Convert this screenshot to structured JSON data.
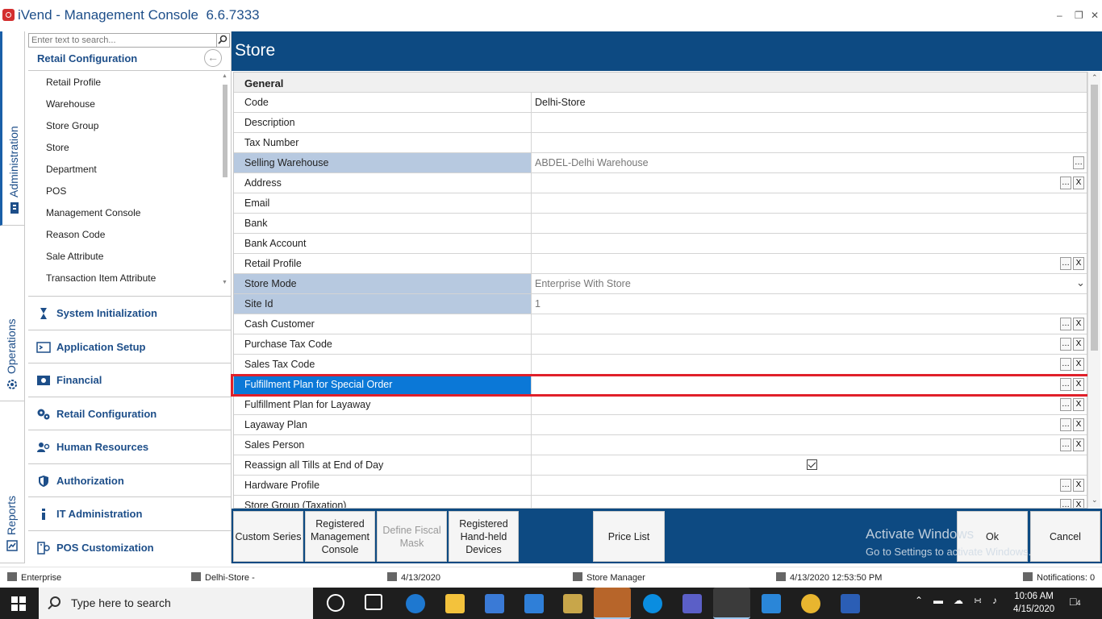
{
  "window": {
    "title": "iVend - Management Console",
    "version": "6.6.7333"
  },
  "vertical_tabs": [
    {
      "label": "Administration",
      "active": true
    },
    {
      "label": "Operations",
      "active": false
    },
    {
      "label": "Reports",
      "active": false
    }
  ],
  "nav": {
    "search_placeholder": "Enter text to search...",
    "section_title": "Retail Configuration",
    "items": [
      "Retail Profile",
      "Warehouse",
      "Store Group",
      "Store",
      "Department",
      "POS",
      "Management Console",
      "Reason Code",
      "Sale Attribute",
      "Transaction Item Attribute"
    ],
    "modules": [
      "System Initialization",
      "Application Setup",
      "Financial",
      "Retail Configuration",
      "Human Resources",
      "Authorization",
      "IT Administration",
      "POS Customization"
    ]
  },
  "main": {
    "title": "Store",
    "group": "General",
    "rows": [
      {
        "label": "Code",
        "value": "Delhi-Store",
        "readonly": false,
        "buttons": ""
      },
      {
        "label": "Description",
        "value": "",
        "readonly": false,
        "buttons": ""
      },
      {
        "label": "Tax Number",
        "value": "",
        "readonly": false,
        "buttons": ""
      },
      {
        "label": "Selling Warehouse",
        "value": "ABDEL-Delhi Warehouse",
        "readonly": true,
        "buttons": "dots"
      },
      {
        "label": "Address",
        "value": "",
        "readonly": false,
        "buttons": "dots-x"
      },
      {
        "label": "Email",
        "value": "",
        "readonly": false,
        "buttons": ""
      },
      {
        "label": "Bank",
        "value": "",
        "readonly": false,
        "buttons": ""
      },
      {
        "label": "Bank Account",
        "value": "",
        "readonly": false,
        "buttons": ""
      },
      {
        "label": "Retail Profile",
        "value": "",
        "readonly": false,
        "buttons": "dots-x"
      },
      {
        "label": "Store Mode",
        "value": "Enterprise With Store",
        "readonly": true,
        "buttons": "dropdown"
      },
      {
        "label": "Site Id",
        "value": "1",
        "readonly": true,
        "buttons": ""
      },
      {
        "label": "Cash Customer",
        "value": "",
        "readonly": false,
        "buttons": "dots-x"
      },
      {
        "label": "Purchase Tax Code",
        "value": "",
        "readonly": false,
        "buttons": "dots-x"
      },
      {
        "label": "Sales Tax Code",
        "value": "",
        "readonly": false,
        "buttons": "dots-x"
      },
      {
        "label": "Fulfillment Plan for Special Order",
        "value": "",
        "readonly": false,
        "buttons": "dots-x",
        "selected": true
      },
      {
        "label": "Fulfillment Plan for Layaway",
        "value": "",
        "readonly": false,
        "buttons": "dots-x"
      },
      {
        "label": "Layaway Plan",
        "value": "",
        "readonly": false,
        "buttons": "dots-x"
      },
      {
        "label": "Sales Person",
        "value": "",
        "readonly": false,
        "buttons": "dots-x"
      },
      {
        "label": "Reassign all Tills at End of Day",
        "value": "",
        "readonly": false,
        "buttons": "checkbox",
        "checked": true
      },
      {
        "label": "Hardware Profile",
        "value": "",
        "readonly": false,
        "buttons": "dots-x"
      },
      {
        "label": "Store Group (Taxation)",
        "value": "",
        "readonly": false,
        "buttons": "dots-x"
      }
    ]
  },
  "footer_buttons": {
    "custom_series": "Custom Series",
    "registered_mc": "Registered Management Console",
    "define_fiscal": "Define Fiscal Mask",
    "handheld": "Registered Hand-held Devices",
    "price_list": "Price List",
    "ok": "Ok",
    "cancel": "Cancel"
  },
  "watermark": {
    "line1": "Activate Windows",
    "line2": "Go to Settings to activate Windows."
  },
  "statusbar": {
    "company": "Enterprise",
    "store": "Delhi-Store -",
    "date": "4/13/2020",
    "user": "Store Manager",
    "login": "4/13/2020 12:53:50 PM",
    "notifications": "Notifications: 0"
  },
  "taskbar": {
    "search_text": "Type here to search",
    "time": "10:06 AM",
    "date": "4/15/2020",
    "badge": "4"
  },
  "colors": {
    "brand_blue": "#0d4a82",
    "selection": "#0b78d7",
    "readonly_label": "#b7c9e0",
    "highlight": "#e0202a"
  }
}
